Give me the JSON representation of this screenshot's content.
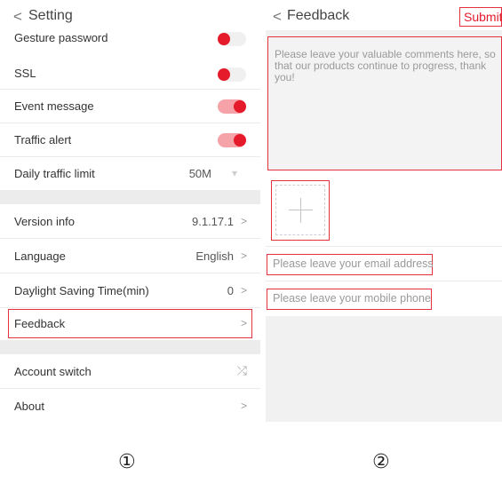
{
  "settings": {
    "back_icon": "chevron-left-icon",
    "back_glyph": "<",
    "title": "Setting",
    "items": [
      {
        "label": "Gesture password"
      },
      {
        "label": "SSL"
      },
      {
        "label": "Event message"
      },
      {
        "label": "Traffic alert"
      },
      {
        "label": "Daily traffic limit",
        "value": "50M"
      },
      {
        "label": "Version info",
        "value": "9.1.17.1"
      },
      {
        "label": "Language",
        "value": "English"
      },
      {
        "label": "Daylight Saving Time(min)",
        "value": "0"
      },
      {
        "label": "Feedback"
      },
      {
        "label": "Account switch"
      },
      {
        "label": "About"
      }
    ],
    "toggles": {
      "gesture_password": false,
      "ssl": false,
      "event_message": true,
      "traffic_alert": true
    },
    "chevron_glyph": ">",
    "dropdown_glyph": "▾",
    "shuffle_glyph": "⤮",
    "accent_color": "#e51a2b",
    "highlight_color": "#e3323d"
  },
  "feedback": {
    "back_glyph": "<",
    "title": "Feedback",
    "submit_label": "Submit",
    "comment_placeholder": "Please leave your valuable comments here, so that our products continue to progress, thank you!",
    "add_image_icon": "plus-icon",
    "email_placeholder": "Please leave your email address",
    "phone_placeholder": "Please leave your mobile phone"
  },
  "captions": {
    "left": "①",
    "right": "②"
  }
}
